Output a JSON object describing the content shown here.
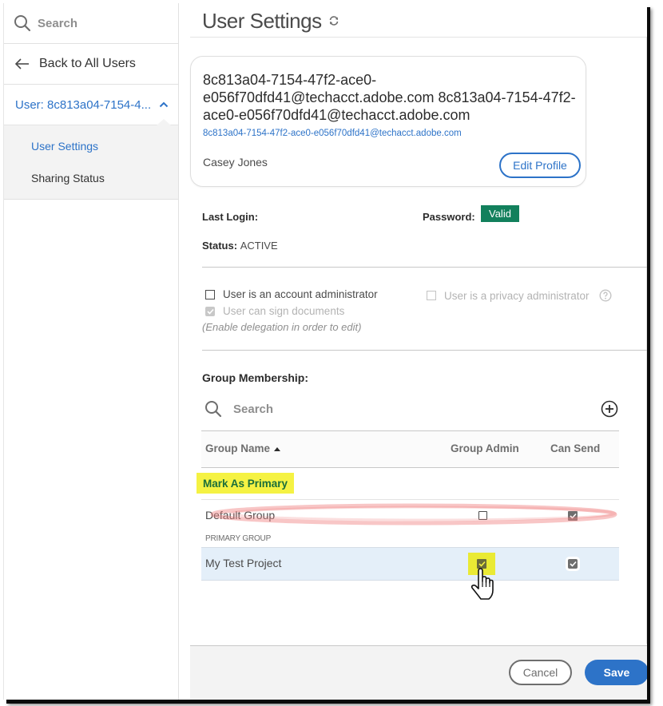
{
  "sidebar": {
    "search_placeholder": "Search",
    "back_label": "Back to All Users",
    "user_label": "User: 8c813a04-7154-4...",
    "sub_items": [
      {
        "label": "User Settings",
        "active": true
      },
      {
        "label": "Sharing Status",
        "active": false
      }
    ]
  },
  "header": {
    "title": "User Settings",
    "refresh_icon": "refresh-icon"
  },
  "profile": {
    "display_name": "8c813a04-7154-47f2-ace0-e056f70dfd41@techacct.adobe.com 8c813a04-7154-47f2-ace0-e056f70dfd41@techacct.adobe.com",
    "email": "8c813a04-7154-47f2-ace0-e056f70dfd41@techacct.adobe.com",
    "full_name": "Casey Jones",
    "edit_button": "Edit Profile"
  },
  "account": {
    "last_login_label": "Last Login:",
    "last_login_value": "",
    "password_label": "Password:",
    "password_status": "Valid",
    "password_status_color": "#12805c",
    "status_label": "Status:",
    "status_value": "ACTIVE"
  },
  "permissions": {
    "account_admin_label": "User is an account administrator",
    "account_admin_checked": false,
    "privacy_admin_label": "User is a privacy administrator",
    "privacy_admin_checked": false,
    "privacy_admin_disabled": true,
    "can_sign_label": "User can sign documents",
    "can_sign_checked": true,
    "can_sign_disabled": true,
    "delegation_note": "(Enable delegation in order to edit)"
  },
  "groups": {
    "title": "Group Membership:",
    "search_placeholder": "Search",
    "columns": [
      "Group Name",
      "Group Admin",
      "Can Send"
    ],
    "sort_column": "Group Name",
    "sort_direction": "ascending",
    "mark_primary_label": "Mark As Primary",
    "primary_group_label": "PRIMARY GROUP",
    "rows": [
      {
        "name": "Default Group",
        "group_admin": false,
        "can_send": true
      },
      {
        "name": "My Test Project",
        "group_admin": true,
        "can_send": true,
        "selected": true
      }
    ]
  },
  "footer": {
    "cancel_label": "Cancel",
    "save_label": "Save"
  },
  "colors": {
    "accent": "#2d73c8",
    "highlight": "#f5f243",
    "selected_row": "#e4eff9"
  }
}
